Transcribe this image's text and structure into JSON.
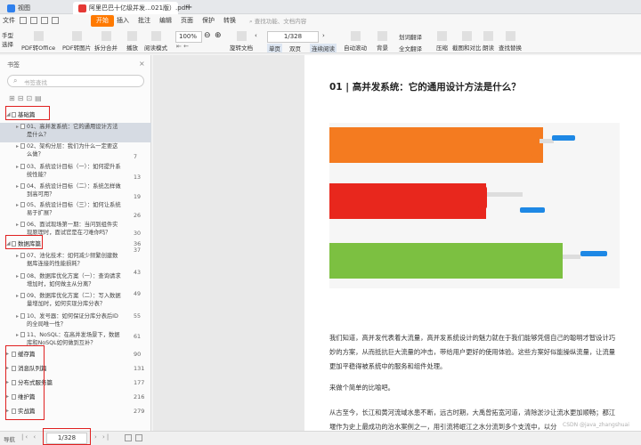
{
  "tabs": {
    "home": "视图",
    "document": "阿里巴巴十亿级并发...021版）.pdf",
    "new_tab": "+"
  },
  "menu": {
    "items": [
      "文件",
      "开始",
      "插入",
      "批注",
      "编辑",
      "页面",
      "保护",
      "转换"
    ],
    "search_placeholder": "查找功能、文档内容"
  },
  "toolbar": {
    "left_labels": [
      "手型",
      "选择"
    ],
    "items": [
      "PDF转Office",
      "PDF转图片",
      "拆分合并",
      "播放",
      "阅读模式",
      "旋转文档",
      "单页",
      "双页",
      "连续阅读",
      "自动滚动",
      "背景",
      "全文翻译",
      "压缩",
      "截图和对比",
      "朗读",
      "查找替换"
    ],
    "zoom": "100%",
    "page_indicator": "1/328",
    "line_wrap": "划词翻译"
  },
  "sidebar": {
    "title": "书签",
    "search_placeholder": "书签查找",
    "sections": [
      {
        "label": "基础篇",
        "entries": [
          {
            "text": "01、高并发系统：它的通用设计方法是什么？",
            "page": ""
          },
          {
            "text": "02、架构分层：我们为什么一定要这么做？",
            "page": "7"
          },
          {
            "text": "03、系统设计目标（一）：如何提升系统性能？",
            "page": "13"
          },
          {
            "text": "04、系统设计目标（二）：系统怎样做到高可用？",
            "page": "19"
          },
          {
            "text": "05、系统设计目标（三）：如何让系统易于扩展？",
            "page": "26"
          },
          {
            "text": "06、面试现场第一期：当问到组件实现原理时，面试官是在刁难你吗？",
            "page": "30"
          }
        ]
      },
      {
        "label": "数据库篇",
        "page": "36",
        "entries": [
          {
            "text": "07、池化技术：如何减少频繁创建数据库连接的性能损耗？",
            "page": "37"
          },
          {
            "text": "08、数据库优化方案（一）：查询请求增加时，如何做主从分离？",
            "page": "43"
          },
          {
            "text": "09、数据库优化方案（二）：写入数据量增加时，如何实现分库分表？",
            "page": "49"
          },
          {
            "text": "10、发号器：如何保证分库分表后ID的全局唯一性？",
            "page": "55"
          },
          {
            "text": "11、NoSQL：在高并发场景下，数据库和NoSQL如何做到互补？",
            "page": "61"
          }
        ]
      }
    ],
    "more_sections": [
      {
        "label": "缓存篇",
        "page": "90"
      },
      {
        "label": "消息队列篇",
        "page": "131"
      },
      {
        "label": "分布式服务篇",
        "page": "177"
      },
      {
        "label": "维护篇",
        "page": "216"
      },
      {
        "label": "实战篇",
        "page": "279"
      }
    ]
  },
  "status": {
    "left": "导航",
    "page": "1/328"
  },
  "document": {
    "heading": "01 | 高并发系统：它的通用设计方法是什么？",
    "paragraphs": [
      "我们知道，高并发代表着大流量，高并发系统设计的魅力就在于我们能够凭借自己的聪明才智设计巧妙的方案，从而抵抗巨大流量的冲击，带给用户更好的使用体验。这些方案好似能操纵流量，让流量更加平稳得被系统中的服务和组件处理。",
      "来做个简单的比喻吧。",
      "从古至今，长江和黄河流域水患不断，远古时期，大禹曾拓宽河道，清除淤沙让流水更加顺畅；都江堰作为史上最成功的治水案例之一，用引流将岷江之水分流到多个支流中，以分"
    ],
    "watermark": "CSDN @java_zhangshuai",
    "colors": {
      "orange": "#f47b20",
      "red": "#e8271d",
      "green": "#7cc041",
      "blue_handle": "#1e88e5",
      "accent": "#ff7a00"
    }
  }
}
